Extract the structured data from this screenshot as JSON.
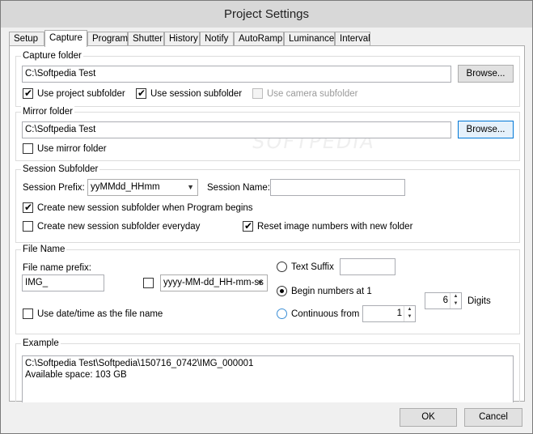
{
  "window": {
    "title": "Project Settings"
  },
  "tabs": [
    {
      "label": "Setup",
      "active": false
    },
    {
      "label": "Capture",
      "active": true
    },
    {
      "label": "Program",
      "active": false
    },
    {
      "label": "Shutter",
      "active": false
    },
    {
      "label": "History",
      "active": false
    },
    {
      "label": "Notify",
      "active": false
    },
    {
      "label": "AutoRamp",
      "active": false
    },
    {
      "label": "Luminance",
      "active": false
    },
    {
      "label": "Interval",
      "active": false
    }
  ],
  "capture_folder": {
    "title": "Capture folder",
    "path": "C:\\Softpedia Test",
    "browse_label": "Browse...",
    "use_project_subfolder": {
      "label": "Use project subfolder",
      "checked": true
    },
    "use_session_subfolder": {
      "label": "Use session subfolder",
      "checked": true
    },
    "use_camera_subfolder": {
      "label": "Use camera subfolder",
      "checked": false,
      "enabled": false
    }
  },
  "mirror_folder": {
    "title": "Mirror folder",
    "path": "C:\\Softpedia Test",
    "browse_label": "Browse...",
    "use_mirror_folder": {
      "label": "Use mirror folder",
      "checked": false
    }
  },
  "session_subfolder": {
    "title": "Session Subfolder",
    "prefix_label": "Session Prefix:",
    "prefix_value": "yyMMdd_HHmm",
    "name_label": "Session Name:",
    "name_value": "",
    "create_when_program": {
      "label": "Create new session subfolder when Program begins",
      "checked": true
    },
    "create_everyday": {
      "label": "Create new session subfolder everyday",
      "checked": false
    },
    "reset_numbers": {
      "label": "Reset image numbers with new folder",
      "checked": true
    }
  },
  "file_name": {
    "title": "File Name",
    "prefix_label": "File name prefix:",
    "prefix_value": "IMG_",
    "datetime_format_checked": false,
    "datetime_format_value": "yyyy-MM-dd_HH-mm-ss",
    "use_datetime": {
      "label": "Use date/time as the file name",
      "checked": false
    },
    "text_suffix": {
      "label": "Text Suffix",
      "selected": false,
      "value": ""
    },
    "begin_numbers": {
      "label": "Begin numbers at 1",
      "selected": true
    },
    "continuous_from": {
      "label": "Continuous from",
      "selected": false,
      "value": "1"
    },
    "digits_value": "6",
    "digits_label": "Digits"
  },
  "example": {
    "title": "Example",
    "text": "C:\\Softpedia Test\\Softpedia\\150716_0742\\IMG_000001\nAvailable space: 103 GB"
  },
  "footer": {
    "ok_label": "OK",
    "cancel_label": "Cancel"
  },
  "watermark": "SOFTPEDIA"
}
